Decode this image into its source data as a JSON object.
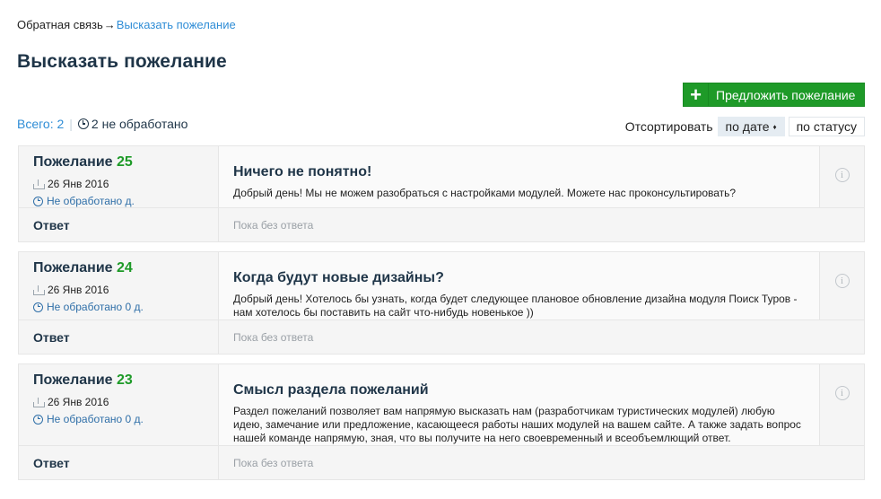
{
  "breadcrumb": {
    "parent": "Обратная связь",
    "separator": "→",
    "current": "Высказать пожелание"
  },
  "page_title": "Высказать пожелание",
  "add_button": {
    "icon": "plus-icon",
    "label": "Предложить пожелание"
  },
  "stats": {
    "total": "Всего: 2",
    "unprocessed": "2 не обработано"
  },
  "sort": {
    "label": "Отсортировать",
    "by_date": "по дате",
    "by_date_arrow": "♦",
    "by_status": "по статусу"
  },
  "colors": {
    "accent_green": "#1e9a28",
    "link_blue": "#2f8dd6",
    "title_dark": "#1f3548"
  },
  "items": [
    {
      "label": "Пожелание",
      "number": "25",
      "date": "26 Янв 2016",
      "status": "Не обработано  д.",
      "title": "Ничего не понятно!",
      "text": "Добрый день! Мы не можем разобраться с настройками модулей. Можете нас проконсультировать?",
      "answer_label": "Ответ",
      "answer_text": "Пока без ответа"
    },
    {
      "label": "Пожелание",
      "number": "24",
      "date": "26 Янв 2016",
      "status": "Не обработано 0 д.",
      "title": "Когда будут новые дизайны?",
      "text": "Добрый день! Хотелось бы узнать, когда будет следующее плановое обновление дизайна модуля Поиск Туров - нам хотелось бы поставить на сайт что-нибудь новенькое ))",
      "answer_label": "Ответ",
      "answer_text": "Пока без ответа"
    },
    {
      "label": "Пожелание",
      "number": "23",
      "date": "26 Янв 2016",
      "status": "Не обработано 0 д.",
      "title": "Смысл раздела пожеланий",
      "text": "Раздел пожеланий позволяет вам напрямую высказать нам (разработчикам туристических модулей) любую идею, замечание или предложение, касающееся работы наших модулей на вашем сайте. А также задать вопрос нашей команде напрямую, зная, что вы получите на него своевременный и всеобъемлющий ответ.",
      "answer_label": "Ответ",
      "answer_text": "Пока без ответа"
    }
  ]
}
